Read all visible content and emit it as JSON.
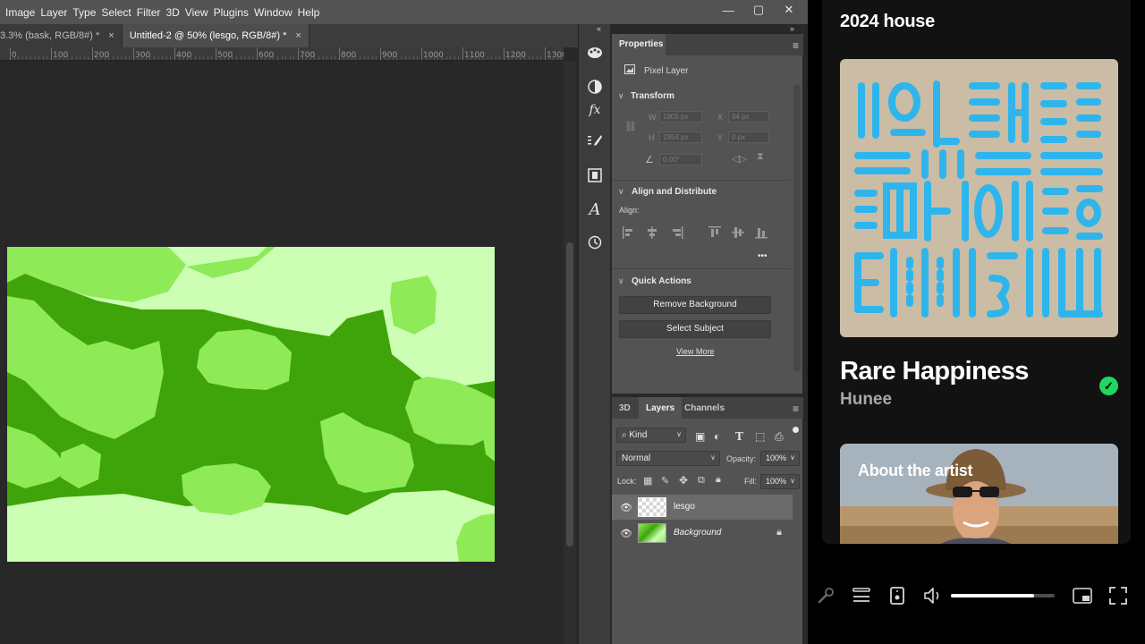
{
  "photoshop": {
    "menu": [
      "Image",
      "Layer",
      "Type",
      "Select",
      "Filter",
      "3D",
      "View",
      "Plugins",
      "Window",
      "Help"
    ],
    "window_controls": [
      "—",
      "▢",
      "✕"
    ],
    "tabs": [
      {
        "label": "3.3% (bask, RGB/8#) *",
        "close": "×",
        "active": false
      },
      {
        "label": "Untitled-2 @ 50% (lesgo, RGB/8#) *",
        "close": "×",
        "active": true
      }
    ],
    "ruler_ticks": [
      "0",
      "100",
      "200",
      "300",
      "400",
      "500",
      "600",
      "700",
      "800",
      "900",
      "1000",
      "1100",
      "1200",
      "1300"
    ],
    "artwork_colors": {
      "light": "#ccfeb3",
      "mid": "#8eea56",
      "dark": "#3ea409"
    },
    "properties": {
      "tab": "Properties",
      "kind": "Pixel Layer",
      "transform": {
        "title": "Transform",
        "w_label": "W",
        "w_value": "1905 px",
        "h_label": "H",
        "h_value": "1954 px",
        "x_label": "X",
        "x_value": "84 px",
        "y_label": "Y",
        "y_value": "0 px",
        "angle_value": "0.00°"
      },
      "align": {
        "title": "Align and Distribute",
        "label": "Align:",
        "more": "•••"
      },
      "quick_actions": {
        "title": "Quick Actions",
        "remove_bg": "Remove Background",
        "select_subject": "Select Subject",
        "view_more": "View More"
      }
    },
    "layers_panel": {
      "tabs": [
        "3D",
        "Layers",
        "Channels"
      ],
      "active_tab": "Layers",
      "filter": "Kind",
      "blend_mode": "Normal",
      "opacity_label": "Opacity:",
      "opacity": "100%",
      "lock_label": "Lock:",
      "fill_label": "Fill:",
      "fill": "100%",
      "layers": [
        {
          "name": "lesgo",
          "selected": true,
          "locked": false
        },
        {
          "name": "Background",
          "selected": false,
          "locked": true
        }
      ]
    }
  },
  "spotify": {
    "playlist": "2024 house",
    "track_title": "Rare Happiness",
    "artist": "Hunee",
    "about_artist": "About the artist",
    "saved_icon": "check-circle-icon",
    "volume": 0.8,
    "accent": "#1ed760",
    "cover_colors": {
      "background": "#cbbca5",
      "ink": "#2fb5ec"
    }
  }
}
